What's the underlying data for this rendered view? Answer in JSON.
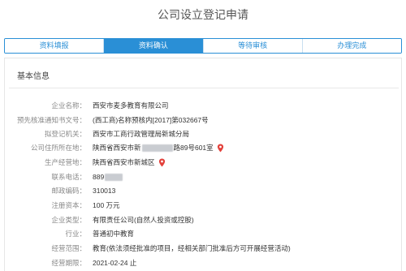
{
  "page": {
    "title": "公司设立登记申请"
  },
  "steps": [
    {
      "label": "资料填报",
      "active": false
    },
    {
      "label": "资料确认",
      "active": true
    },
    {
      "label": "等待审核",
      "active": false
    },
    {
      "label": "办理完成",
      "active": false
    }
  ],
  "section": {
    "title": "基本信息"
  },
  "fields": [
    {
      "label": "企业名称：",
      "value": "西安市麦多教育有限公司"
    },
    {
      "label": "预先核准通知书文号：",
      "value": "(西工商)名称预核内[2017]第032667号"
    },
    {
      "label": "拟登记机关：",
      "value": "西安市工商行政管理局新城分局"
    },
    {
      "label": "公司住所所在地：",
      "value_prefix": "陕西省西安市新",
      "value_suffix": "路89号601室"
    },
    {
      "label": "生产经营地：",
      "value": "陕西省西安市新城区"
    },
    {
      "label": "联系电话：",
      "value_prefix": "889"
    },
    {
      "label": "邮政编码：",
      "value": "310013"
    },
    {
      "label": "注册资本：",
      "value": "100 万元"
    },
    {
      "label": "企业类型：",
      "value": "有限责任公司(自然人投资或控股)"
    },
    {
      "label": "行业：",
      "value": "普通初中教育"
    },
    {
      "label": "经营范围：",
      "value": "教育(依法须经批准的项目，经相关部门批准后方可开展经营活动)"
    },
    {
      "label": "经营期限：",
      "value": "2021-02-24 止"
    }
  ],
  "colors": {
    "accent": "#2a8fd6",
    "pin": "#e3413b"
  },
  "icons": {
    "location": "map-pin-icon"
  }
}
